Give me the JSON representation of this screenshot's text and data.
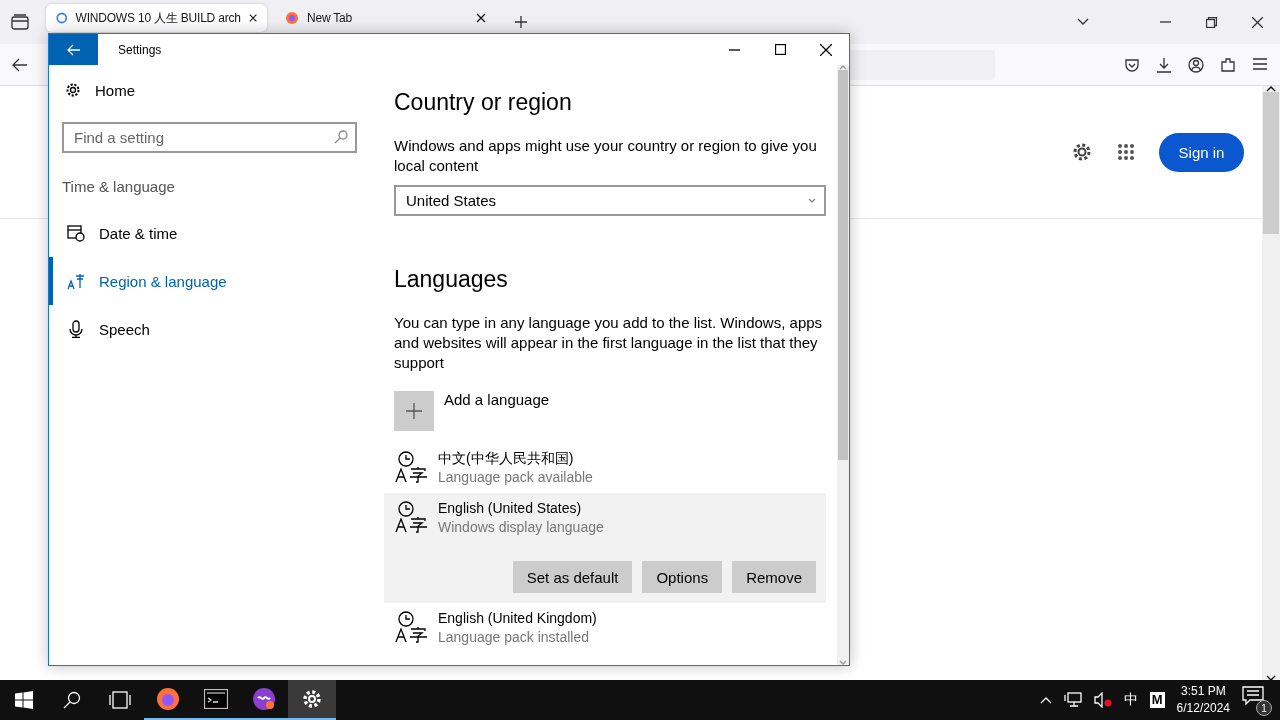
{
  "browser": {
    "tabs": [
      {
        "title": "WINDOWS 10 人生 BUILD arch",
        "selected": true
      },
      {
        "title": "New Tab",
        "selected": false
      }
    ],
    "page": {
      "sign_in": "Sign in"
    }
  },
  "settings": {
    "window": {
      "title": "Settings"
    },
    "sidebar": {
      "home": "Home",
      "search": {
        "placeholder": "Find a setting"
      },
      "section": "Time & language",
      "items": [
        {
          "label": "Date & time",
          "selected": false
        },
        {
          "label": "Region & language",
          "selected": true
        },
        {
          "label": "Speech",
          "selected": false
        }
      ]
    },
    "country": {
      "heading": "Country or region",
      "description": "Windows and apps might use your country or region to give you local content",
      "value": "United States"
    },
    "languages": {
      "heading": "Languages",
      "description": "You can type in any language you add to the list. Windows, apps and websites will appear in the first language in the list that they support",
      "add": "Add a language",
      "items": [
        {
          "name": "中文(中华人民共和国)",
          "status": "Language pack available",
          "selected": false
        },
        {
          "name": "English (United States)",
          "status": "Windows display language",
          "selected": true
        },
        {
          "name": "English (United Kingdom)",
          "status": "Language pack installed",
          "selected": false
        }
      ],
      "actions": [
        "Set as default",
        "Options",
        "Remove"
      ]
    }
  },
  "taskbar": {
    "ime": "中",
    "input": "M",
    "time": "3:51 PM",
    "date": "6/12/2024",
    "notifications": "1"
  }
}
